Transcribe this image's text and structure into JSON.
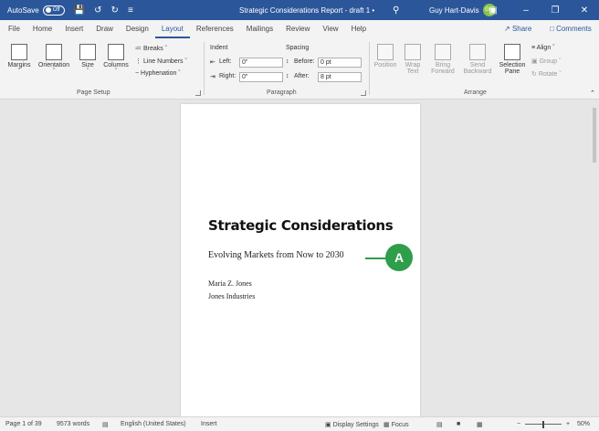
{
  "titlebar": {
    "autosave_label": "AutoSave",
    "autosave_state": "Off",
    "doc_title": "Strategic Considerations Report - draft 1 •",
    "user_name": "Guy Hart-Davis",
    "user_initials": "GH"
  },
  "tabs": [
    "File",
    "Home",
    "Insert",
    "Draw",
    "Design",
    "Layout",
    "References",
    "Mailings",
    "Review",
    "View",
    "Help"
  ],
  "active_tab": "Layout",
  "share_label": "Share",
  "comments_label": "Comments",
  "ribbon": {
    "margins": "Margins",
    "orientation": "Orientation",
    "size": "Size",
    "columns": "Columns",
    "breaks": "Breaks",
    "line_numbers": "Line Numbers",
    "hyphenation": "Hyphenation",
    "page_setup": "Page Setup",
    "indent": "Indent",
    "left_label": "Left:",
    "left_value": "0\"",
    "right_label": "Right:",
    "right_value": "0\"",
    "spacing": "Spacing",
    "before_label": "Before:",
    "before_value": "0 pt",
    "after_label": "After:",
    "after_value": "8 pt",
    "paragraph": "Paragraph",
    "position": "Position",
    "wrap_text": "Wrap Text",
    "bring_forward": "Bring Forward",
    "send_backward": "Send Backward",
    "selection_pane": "Selection Pane",
    "align": "Align",
    "group": "Group",
    "rotate": "Rotate",
    "arrange": "Arrange"
  },
  "document": {
    "title": "Strategic Considerations",
    "subtitle": "Evolving Markets from Now to 2030",
    "author": "Maria Z. Jones",
    "company": "Jones Industries"
  },
  "callout_label": "A",
  "status": {
    "page": "Page 1 of 39",
    "words": "9573 words",
    "language": "English (United States)",
    "mode": "Insert",
    "display_settings": "Display Settings",
    "focus": "Focus",
    "zoom": "50%",
    "zoom_fraction": 0.5
  },
  "colors": {
    "titlebar": "#2b579a",
    "callout": "#2e9e4a",
    "accent": "#2b579a"
  }
}
